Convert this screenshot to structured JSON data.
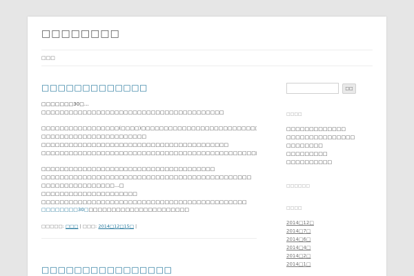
{
  "site": {
    "title": "□□□□□□□□"
  },
  "nav": {
    "items": [
      "□□□"
    ]
  },
  "posts": [
    {
      "title": "□□□□□□□□□□□□□",
      "lines": [
        "□□□□□□□30□…",
        "□□□□□□□□□□□□□□□□□□□□□□□□□□□□□□□□□□□□□□□□",
        "",
        "□□□□□□□□□□□□□□□□□(□□□□)□□□□□□□□□□□□□□□□□□□□□□□□□□□□□□□□",
        "□□□□□□□□□□□□□□□□□□□□□□□",
        "□□□□□□□□□□□□□□□□□□□□□□□□□□□□□□□□□□□□□□□□□",
        "□□□□□□□□□□□□□□□□□□□□□□□□□□□□□□□□□□□□□□□□□□□□□□□□□□□□□□□□",
        "",
        "□□□□□□□□□□□□□□□□□□□□□□□□□□□□□□□□□□□□□□",
        "□□□□□□□□□□□□□□□□□□□□□□□□□□□□□□□□□□□□□□□□□□□□□□",
        "□□□□□□□□□□□□□□□□…□",
        "□□□□□□□□□□□□□□□□□□□□□",
        "□□□□□□□□□□□□□□□□□□□□□□□□□□□□□□□□□□□□□□□□□□□□□"
      ],
      "read_more": "□□□□□□□□30□",
      "read_more_tail": "□□□□□□□□□□□□□□□□□□□□□□",
      "meta": {
        "category_label": "□□□□□:",
        "category": "□□□",
        "date_label": "| □□□:",
        "date": "2014□12□15□",
        "close": "|"
      }
    },
    {
      "title": "□□□□□□□□□□□□□□□□"
    }
  ],
  "sidebar": {
    "search": {
      "placeholder": "",
      "value": "",
      "button": "□□"
    },
    "widgets": [
      {
        "title": "□□□□",
        "items": [
          "□□□□□□□□□□□□□",
          "□□□□□□□□□□□□□□□",
          "□□□□□□□□",
          "□□□□□□□□□",
          "□□□□□□□□□□"
        ]
      },
      {
        "title": "□□□□□□",
        "items": []
      },
      {
        "title": "□□□□",
        "archives": [
          "2014□12□",
          "2014□7□",
          "2014□6□",
          "2014□4□",
          "2014□2□",
          "2014□1□"
        ]
      }
    ]
  }
}
